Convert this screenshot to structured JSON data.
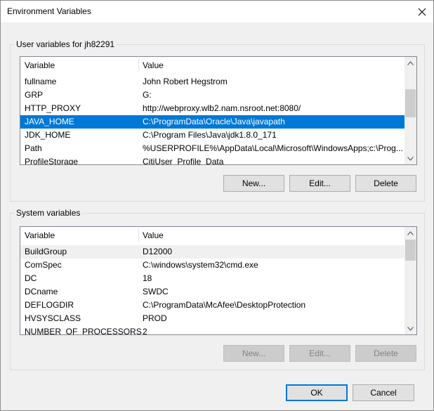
{
  "window": {
    "title": "Environment Variables",
    "close_icon": "close-icon"
  },
  "user_vars": {
    "group_label": "User variables for jh82291",
    "columns": [
      "Variable",
      "Value"
    ],
    "rows": [
      {
        "name": "fullname",
        "value": "John Robert Hegstrom"
      },
      {
        "name": "GRP",
        "value": "G:"
      },
      {
        "name": "HTTP_PROXY",
        "value": "http://webproxy.wlb2.nam.nsroot.net:8080/"
      },
      {
        "name": "JAVA_HOME",
        "value": "C:\\ProgramData\\Oracle\\Java\\javapath"
      },
      {
        "name": "JDK_HOME",
        "value": "C:\\Program Files\\Java\\jdk1.8.0_171"
      },
      {
        "name": "Path",
        "value": "%USERPROFILE%\\AppData\\Local\\Microsoft\\WindowsApps;c:\\Prog..."
      },
      {
        "name": "ProfileStorage",
        "value": "CitiUser_Profile_Data"
      }
    ],
    "selected_index": 3,
    "buttons": {
      "new": "New...",
      "edit": "Edit...",
      "delete": "Delete"
    }
  },
  "system_vars": {
    "group_label": "System variables",
    "columns": [
      "Variable",
      "Value"
    ],
    "rows": [
      {
        "name": "BuildGroup",
        "value": "D12000"
      },
      {
        "name": "ComSpec",
        "value": "C:\\windows\\system32\\cmd.exe"
      },
      {
        "name": "DC",
        "value": "18"
      },
      {
        "name": "DCname",
        "value": "SWDC"
      },
      {
        "name": "DEFLOGDIR",
        "value": "C:\\ProgramData\\McAfee\\DesktopProtection"
      },
      {
        "name": "HVSYSCLASS",
        "value": "PROD"
      },
      {
        "name": "NUMBER_OF_PROCESSORS",
        "value": "2"
      }
    ],
    "highlighted_index": 0,
    "buttons": {
      "new": "New...",
      "edit": "Edit...",
      "delete": "Delete"
    },
    "buttons_disabled": true
  },
  "dialog_buttons": {
    "ok": "OK",
    "cancel": "Cancel"
  },
  "colors": {
    "selection": "#0078d7",
    "default_button_border": "#0078d7"
  }
}
